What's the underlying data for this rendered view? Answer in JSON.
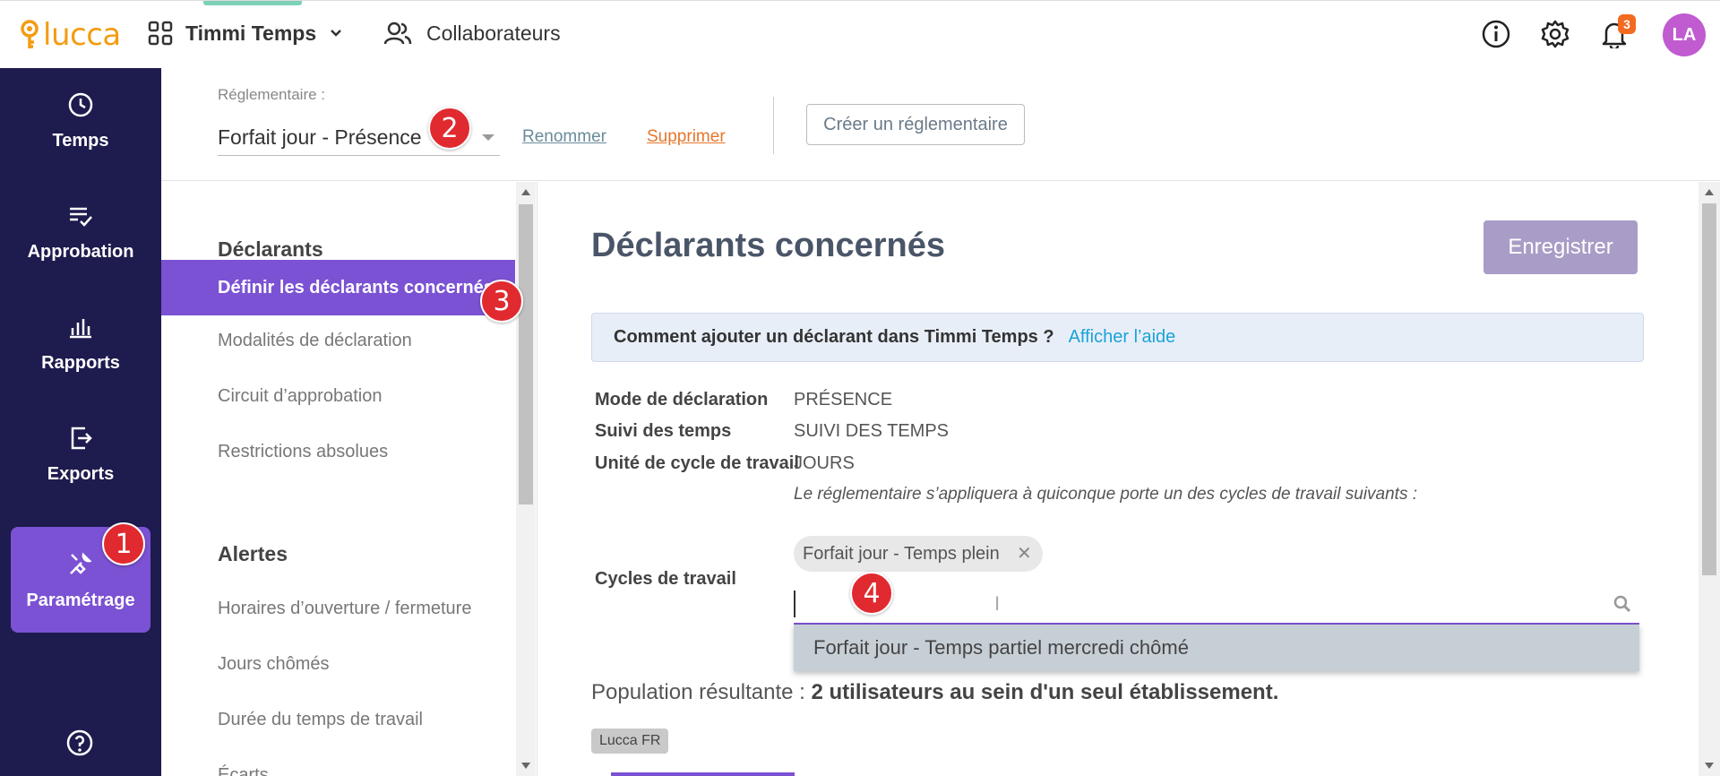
{
  "topbar": {
    "logo_text": "lucca",
    "app_name": "Timmi Temps",
    "collab_label": "Collaborateurs",
    "notif_count": "3",
    "avatar_initials": "LA"
  },
  "sidebar": {
    "items": [
      {
        "label": "Temps",
        "icon": "clock-icon"
      },
      {
        "label": "Approbation",
        "icon": "checklist-icon"
      },
      {
        "label": "Rapports",
        "icon": "bar-chart-icon"
      },
      {
        "label": "Exports",
        "icon": "export-icon"
      },
      {
        "label": "Paramétrage",
        "icon": "tools-icon"
      }
    ]
  },
  "markers": [
    "1",
    "2",
    "3",
    "4"
  ],
  "reglementaire": {
    "label": "Réglementaire :",
    "value": "Forfait jour - Présence",
    "rename": "Renommer",
    "delete": "Supprimer",
    "create": "Créer un réglementaire"
  },
  "subnav": {
    "section1": "Déclarants",
    "items1": [
      "Définir les déclarants concernés",
      "Modalités de déclaration",
      "Circuit d’approbation",
      "Restrictions absolues"
    ],
    "section2": "Alertes",
    "items2": [
      "Horaires d’ouverture / fermeture",
      "Jours chômés",
      "Durée du temps de travail",
      "Écarts"
    ]
  },
  "main": {
    "title": "Déclarants concernés",
    "save": "Enregistrer",
    "help_question": "Comment ajouter un déclarant dans Timmi Temps ?",
    "help_link": "Afficher l’aide",
    "rows": [
      {
        "k": "Mode de déclaration",
        "v": "PRÉSENCE"
      },
      {
        "k": "Suivi des temps",
        "v": "SUIVI DES TEMPS"
      },
      {
        "k": "Unité de cycle de travail",
        "v": "JOURS"
      }
    ],
    "note": "Le réglementaire s’appliquera à quiconque porte un des cycles de travail suivants :",
    "cycles_label": "Cycles de travail",
    "chip": "Forfait jour - Temps plein",
    "dropdown_option": "Forfait jour - Temps partiel mercredi chômé",
    "population_prefix": "Population résultante :",
    "population_value": "2 utilisateurs au sein d'un seul établissement.",
    "etab_badge": "Lucca FR"
  },
  "colors": {
    "sidebar_bg": "#1e1b4e",
    "accent_purple": "#7b52d3",
    "marker_red": "#e02a2f"
  }
}
